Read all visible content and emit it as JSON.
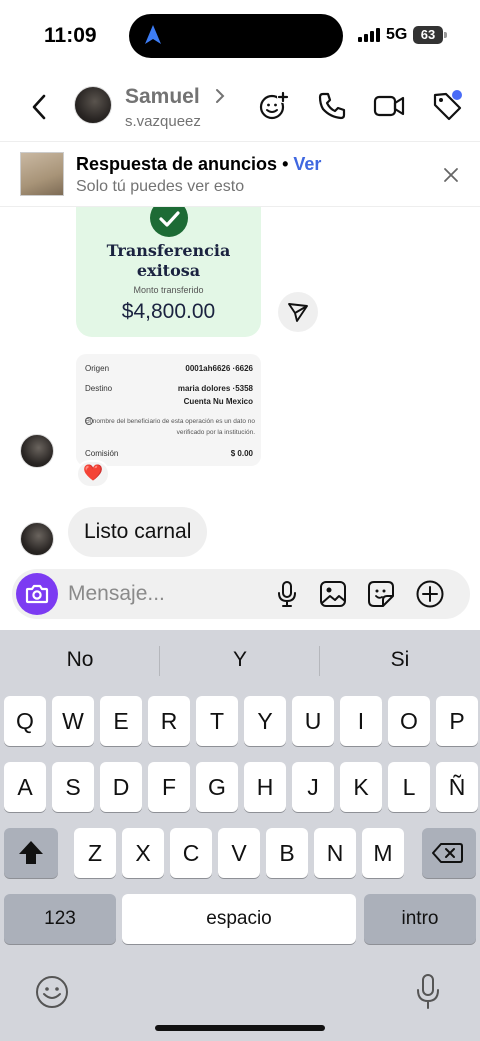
{
  "status_bar": {
    "time": "11:09",
    "network": "5G",
    "battery": "63"
  },
  "header": {
    "contact_name": "Samuel",
    "username": "s.vazqueez",
    "icons": [
      "back-icon",
      "add-friend-icon",
      "phone-icon",
      "video-icon",
      "tag-icon"
    ]
  },
  "ad_banner": {
    "title": "Respuesta de anuncios",
    "separator": "•",
    "link": "Ver",
    "subtitle": "Solo tú puedes ver esto"
  },
  "transfer_card": {
    "title": "Transferencia exitosa",
    "amount_label": "Monto transferido",
    "amount": "$4,800.00"
  },
  "details_card": {
    "origin_label": "Origen",
    "origin_value": "0001ah6626 ·6626",
    "dest_label": "Destino",
    "dest_value_1": "maria dolores ·5358",
    "dest_value_2": "Cuenta Nu Mexico",
    "note": "El nombre del beneficiario de esta operación es un dato no verificado por la institución.",
    "fee_label": "Comisión",
    "fee_value": "$ 0.00"
  },
  "reaction": "❤️",
  "message_text": "Listo carnal",
  "composer": {
    "placeholder": "Mensaje..."
  },
  "keyboard": {
    "suggestions": [
      "No",
      "Y",
      "Si"
    ],
    "row1": [
      "Q",
      "W",
      "E",
      "R",
      "T",
      "Y",
      "U",
      "I",
      "O",
      "P"
    ],
    "row2": [
      "A",
      "S",
      "D",
      "F",
      "G",
      "H",
      "J",
      "K",
      "L",
      "Ñ"
    ],
    "row3": [
      "Z",
      "X",
      "C",
      "V",
      "B",
      "N",
      "M"
    ],
    "numbers_key": "123",
    "space_key": "espacio",
    "return_key": "intro"
  },
  "colors": {
    "accent": "#3f67e0",
    "camera": "#7c3bf2",
    "transfer_bg": "#e3f7e6",
    "check": "#1d6b35"
  }
}
